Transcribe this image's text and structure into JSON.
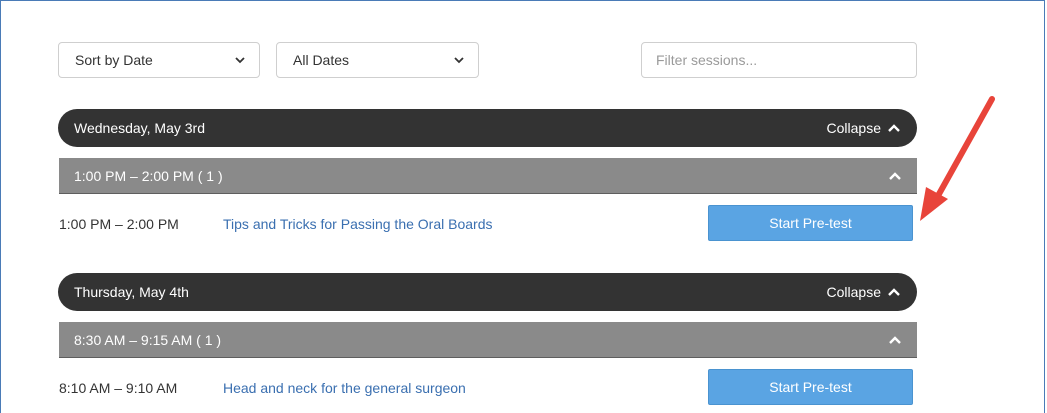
{
  "filters": {
    "sort_select": {
      "selected": "Sort by Date"
    },
    "date_select": {
      "selected": "All Dates"
    },
    "search": {
      "placeholder": "Filter sessions..."
    }
  },
  "days": [
    {
      "label": "Wednesday, May 3rd",
      "collapse_label": "Collapse",
      "slot": {
        "label": "1:00 PM – 2:00 PM   ( 1 )"
      },
      "session": {
        "time": "1:00 PM – 2:00 PM",
        "title": "Tips and Tricks for Passing the Oral Boards",
        "button": "Start Pre-test"
      }
    },
    {
      "label": "Thursday, May 4th",
      "collapse_label": "Collapse",
      "slot": {
        "label": "8:30 AM – 9:15 AM   ( 1 )"
      },
      "session": {
        "time": "8:10 AM – 9:10 AM",
        "title": "Head and neck for the general surgeon",
        "button": "Start Pre-test"
      }
    }
  ],
  "colors": {
    "day_bar": "#333333",
    "slot_bar": "#8a8a8a",
    "link": "#3a6fb0",
    "button": "#5aa4e3",
    "annotation_arrow": "#e8443a"
  },
  "icons": {
    "select_chevron": "chevron-down-icon",
    "collapse_chevron": "chevron-up-icon",
    "annotation": "red-arrow-icon"
  }
}
